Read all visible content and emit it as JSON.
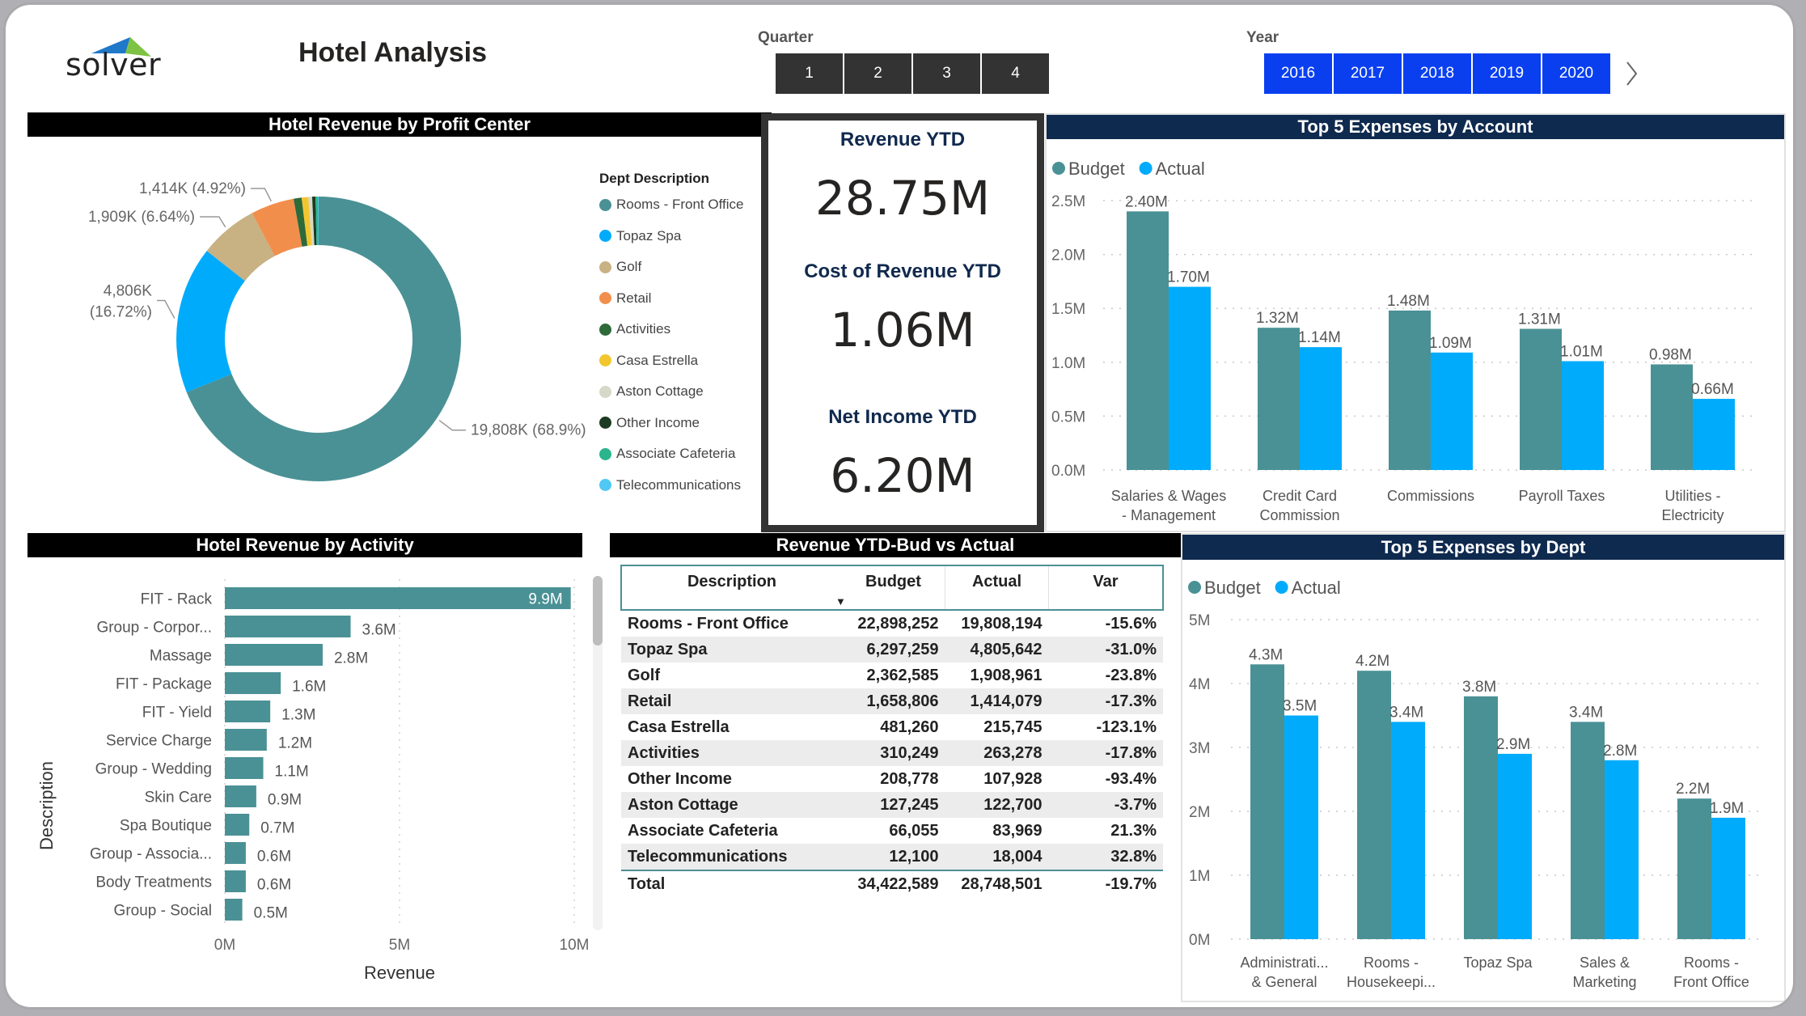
{
  "header": {
    "logo_text": "solver",
    "title": "Hotel Analysis",
    "quarter_label": "Quarter",
    "quarters": [
      "1",
      "2",
      "3",
      "4"
    ],
    "year_label": "Year",
    "years": [
      "2016",
      "2017",
      "2018",
      "2019",
      "2020"
    ],
    "next_icon": "chevron-right-icon"
  },
  "colors": {
    "teal": "#4a9195",
    "blue": "#00abfb",
    "navy": "#0f2a4f",
    "year_button": "#0a3ff0",
    "quarter_button": "#333333"
  },
  "kpis": [
    {
      "label": "Revenue YTD",
      "value": "28.75M"
    },
    {
      "label": "Cost of Revenue YTD",
      "value": "1.06M"
    },
    {
      "label": "Net Income YTD",
      "value": "6.20M"
    }
  ],
  "profit_center": {
    "title": "Hotel Revenue by Profit Center",
    "legend_title": "Dept Description"
  },
  "activity": {
    "title": "Hotel Revenue by Activity"
  },
  "table": {
    "title": "Revenue YTD-Bud vs Actual",
    "columns": [
      "Description",
      "Budget",
      "Actual",
      "Var"
    ],
    "rows": [
      [
        "Rooms - Front Office",
        "22,898,252",
        "19,808,194",
        "-15.6%"
      ],
      [
        "Topaz Spa",
        "6,297,259",
        "4,805,642",
        "-31.0%"
      ],
      [
        "Golf",
        "2,362,585",
        "1,908,961",
        "-23.8%"
      ],
      [
        "Retail",
        "1,658,806",
        "1,414,079",
        "-17.3%"
      ],
      [
        "Casa Estrella",
        "481,260",
        "215,745",
        "-123.1%"
      ],
      [
        "Activities",
        "310,249",
        "263,278",
        "-17.8%"
      ],
      [
        "Other Income",
        "208,778",
        "107,928",
        "-93.4%"
      ],
      [
        "Aston Cottage",
        "127,245",
        "122,700",
        "-3.7%"
      ],
      [
        "Associate Cafeteria",
        "66,055",
        "83,969",
        "21.3%"
      ],
      [
        "Telecommunications",
        "12,100",
        "18,004",
        "32.8%"
      ]
    ],
    "total": [
      "Total",
      "34,422,589",
      "28,748,501",
      "-19.7%"
    ]
  },
  "chart_data": [
    {
      "id": "profit_center",
      "type": "pie",
      "title": "Hotel Revenue by Profit Center",
      "legend_title": "Dept Description",
      "legend_position": "right",
      "categories": [
        "Rooms - Front Office",
        "Topaz Spa",
        "Golf",
        "Retail",
        "Activities",
        "Casa Estrella",
        "Aston Cottage",
        "Other Income",
        "Associate Cafeteria",
        "Telecommunications"
      ],
      "values": [
        19808,
        4806,
        1909,
        1414,
        263,
        216,
        123,
        108,
        84,
        18
      ],
      "colors": [
        "#4a9195",
        "#00abfb",
        "#c8b183",
        "#f28e4c",
        "#2d6a3a",
        "#f2c62f",
        "#d6d8c8",
        "#1d3b22",
        "#2ab58e",
        "#4fc8f5"
      ],
      "data_labels": [
        {
          "category": "Rooms - Front Office",
          "text": "19,808K (68.9%)"
        },
        {
          "category": "Topaz Spa",
          "text": "4,806K (16.72%)"
        },
        {
          "category": "Golf",
          "text": "1,909K (6.64%)"
        },
        {
          "category": "Retail",
          "text": "1,414K (4.92%)"
        }
      ],
      "unit": "K"
    },
    {
      "id": "expenses_account",
      "type": "bar",
      "title": "Top 5 Expenses by Account",
      "categories": [
        "Salaries & Wages - Management",
        "Credit Card Commission",
        "Commissions",
        "Payroll Taxes",
        "Utilities - Electricity"
      ],
      "category_lines": [
        [
          "Salaries & Wages",
          "- Management"
        ],
        [
          "Credit Card",
          "Commission"
        ],
        [
          "Commissions"
        ],
        [
          "Payroll Taxes"
        ],
        [
          "Utilities -",
          "Electricity"
        ]
      ],
      "series": [
        {
          "name": "Budget",
          "values": [
            2.4,
            1.32,
            1.48,
            1.31,
            0.98
          ],
          "labels": [
            "2.40M",
            "1.32M",
            "1.48M",
            "1.31M",
            "0.98M"
          ],
          "color": "#4a9195"
        },
        {
          "name": "Actual",
          "values": [
            1.7,
            1.14,
            1.09,
            1.01,
            0.66
          ],
          "labels": [
            "1.70M",
            "1.14M",
            "1.09M",
            "1.01M",
            "0.66M"
          ],
          "color": "#00abfb"
        }
      ],
      "yticks": [
        "0.0M",
        "0.5M",
        "1.0M",
        "1.5M",
        "2.0M",
        "2.5M"
      ],
      "ylim": [
        0,
        2.5
      ],
      "ylabel": "",
      "xlabel": "",
      "grid": true,
      "legend_position": "top-left"
    },
    {
      "id": "activity",
      "type": "bar",
      "orientation": "horizontal",
      "title": "Hotel Revenue by Activity",
      "categories": [
        "FIT - Rack",
        "Group - Corpor...",
        "Massage",
        "FIT - Package",
        "FIT - Yield",
        "Service Charge",
        "Group - Wedding",
        "Skin Care",
        "Spa Boutique",
        "Group - Associa...",
        "Body Treatments",
        "Group - Social"
      ],
      "values": [
        9.9,
        3.6,
        2.8,
        1.6,
        1.3,
        1.2,
        1.1,
        0.9,
        0.7,
        0.6,
        0.6,
        0.5
      ],
      "labels": [
        "9.9M",
        "3.6M",
        "2.8M",
        "1.6M",
        "1.3M",
        "1.2M",
        "1.1M",
        "0.9M",
        "0.7M",
        "0.6M",
        "0.6M",
        "0.5M"
      ],
      "color": "#4a9195",
      "xticks": [
        "0M",
        "5M",
        "10M"
      ],
      "xlim": [
        0,
        10
      ],
      "xlabel": "Revenue",
      "ylabel": "Description",
      "grid": true
    },
    {
      "id": "expenses_dept",
      "type": "bar",
      "title": "Top 5 Expenses by Dept",
      "categories": [
        "Administrati... & General",
        "Rooms - Housekeepi...",
        "Topaz Spa",
        "Sales & Marketing",
        "Rooms - Front Office"
      ],
      "category_lines": [
        [
          "Administrati...",
          "& General"
        ],
        [
          "Rooms -",
          "Housekeepi..."
        ],
        [
          "Topaz Spa"
        ],
        [
          "Sales &",
          "Marketing"
        ],
        [
          "Rooms -",
          "Front Office"
        ]
      ],
      "series": [
        {
          "name": "Budget",
          "values": [
            4.3,
            4.2,
            3.8,
            3.4,
            2.2
          ],
          "labels": [
            "4.3M",
            "4.2M",
            "3.8M",
            "3.4M",
            "2.2M"
          ],
          "color": "#4a9195"
        },
        {
          "name": "Actual",
          "values": [
            3.5,
            3.4,
            2.9,
            2.8,
            1.9
          ],
          "labels": [
            "3.5M",
            "3.4M",
            "2.9M",
            "2.8M",
            "1.9M"
          ],
          "color": "#00abfb"
        }
      ],
      "yticks": [
        "0M",
        "1M",
        "2M",
        "3M",
        "4M",
        "5M"
      ],
      "ylim": [
        0,
        5
      ],
      "ylabel": "",
      "xlabel": "",
      "grid": true,
      "legend_position": "top-left"
    }
  ]
}
